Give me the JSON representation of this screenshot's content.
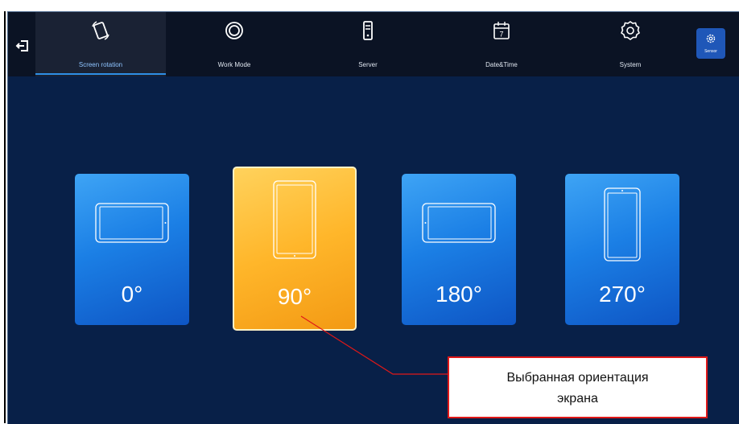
{
  "tabs": [
    {
      "label": "Screen rotation",
      "icon": "screen-rotation-icon",
      "active": true
    },
    {
      "label": "Work Mode",
      "icon": "work-mode-icon",
      "active": false
    },
    {
      "label": "Server",
      "icon": "server-icon",
      "active": false
    },
    {
      "label": "Date&Time",
      "icon": "calendar-icon",
      "active": false
    },
    {
      "label": "System",
      "icon": "gear-icon",
      "active": false
    }
  ],
  "sensor": {
    "label": "Sensor"
  },
  "calendar_day": "7",
  "rotations": [
    {
      "label": "0°",
      "selected": false
    },
    {
      "label": "90°",
      "selected": true
    },
    {
      "label": "180°",
      "selected": false
    },
    {
      "label": "270°",
      "selected": false
    }
  ],
  "callout": {
    "line1": "Выбранная ориентация",
    "line2": "экрана"
  },
  "colors": {
    "card": "#1b7fe5",
    "selected": "#ffb62a",
    "background": "#082048",
    "topbar": "#0b1324",
    "accent": "#2e8fe6",
    "callout_border": "#e01818"
  }
}
